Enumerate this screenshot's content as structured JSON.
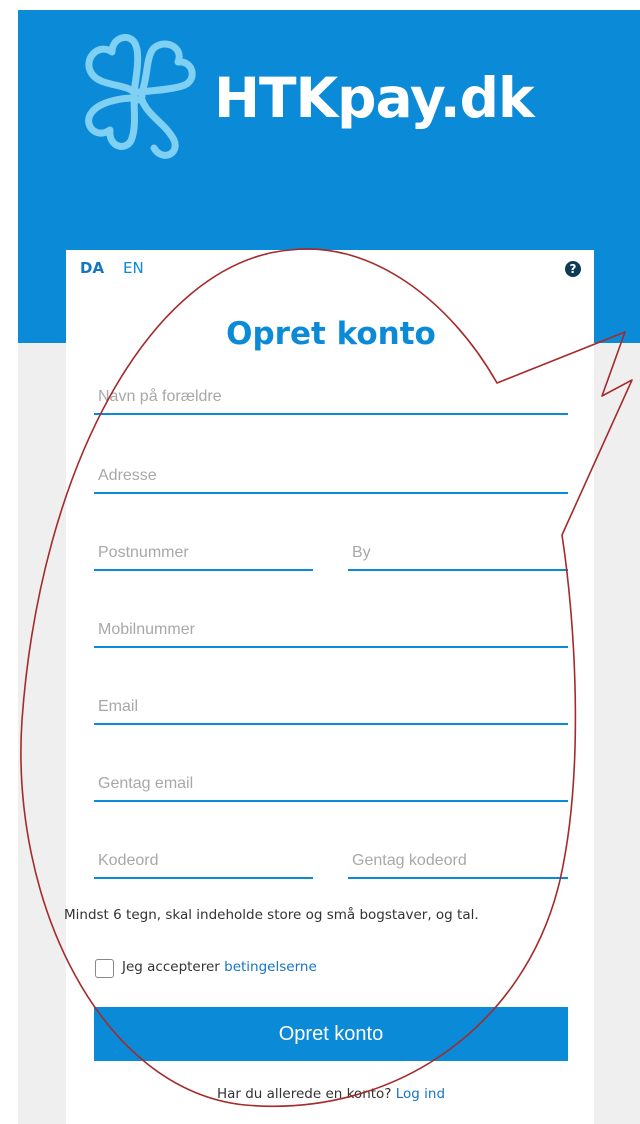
{
  "brand": {
    "name": "HTKpay.dk",
    "logo_icon": "four-leaf-clover-icon"
  },
  "language": {
    "options": [
      "DA",
      "EN"
    ],
    "selected": "DA"
  },
  "help": {
    "icon": "question-circle-icon"
  },
  "form": {
    "title": "Opret konto",
    "fields": {
      "parent_name": {
        "placeholder": "Navn på forældre"
      },
      "address": {
        "placeholder": "Adresse"
      },
      "postal_code": {
        "placeholder": "Postnummer"
      },
      "city": {
        "placeholder": "By"
      },
      "mobile": {
        "placeholder": "Mobilnummer"
      },
      "email": {
        "placeholder": "Email"
      },
      "repeat_email": {
        "placeholder": "Gentag email"
      },
      "password": {
        "placeholder": "Kodeord"
      },
      "repeat_password": {
        "placeholder": "Gentag kodeord"
      }
    },
    "password_hint": "Mindst 6 tegn, skal indeholde store og små bogstaver, og tal.",
    "terms": {
      "prefix": "Jeg accepterer ",
      "link": "betingelserne",
      "checked": false
    },
    "submit_label": "Opret konto",
    "login_prompt": {
      "text": "Har du allerede en konto? ",
      "link": "Log ind"
    }
  },
  "colors": {
    "primary": "#0b8ad8",
    "header_bg": "#0b8ad8",
    "page_bg": "#efefef",
    "annotation": "#a52a2a",
    "link": "#1576c4"
  }
}
